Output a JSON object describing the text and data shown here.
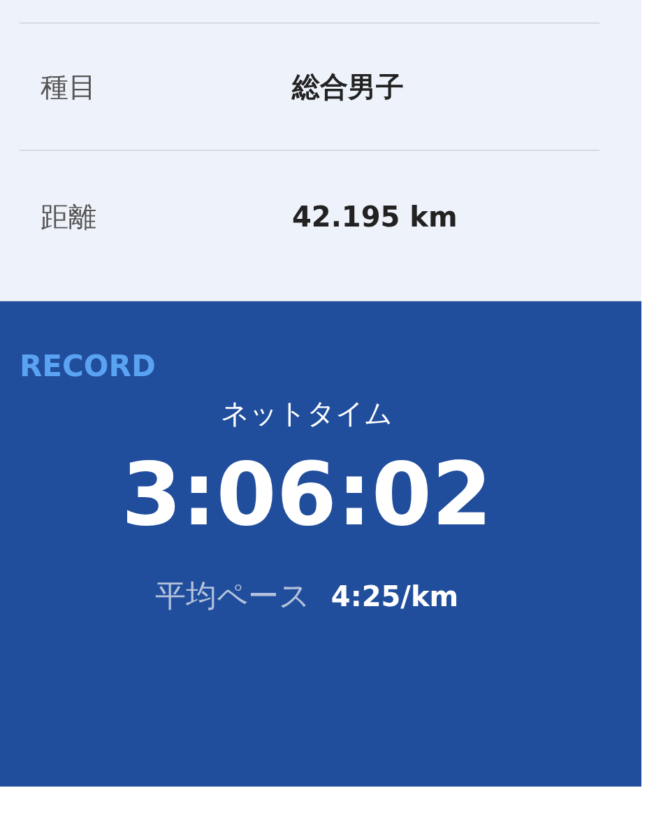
{
  "details": [
    {
      "label": "種目",
      "value": "総合男子"
    },
    {
      "label": "距離",
      "value": "42.195 km"
    }
  ],
  "record": {
    "heading": "RECORD",
    "time_label": "ネットタイム",
    "time": "3:06:02",
    "pace_label": "平均ペース",
    "pace": "4:25/km"
  }
}
